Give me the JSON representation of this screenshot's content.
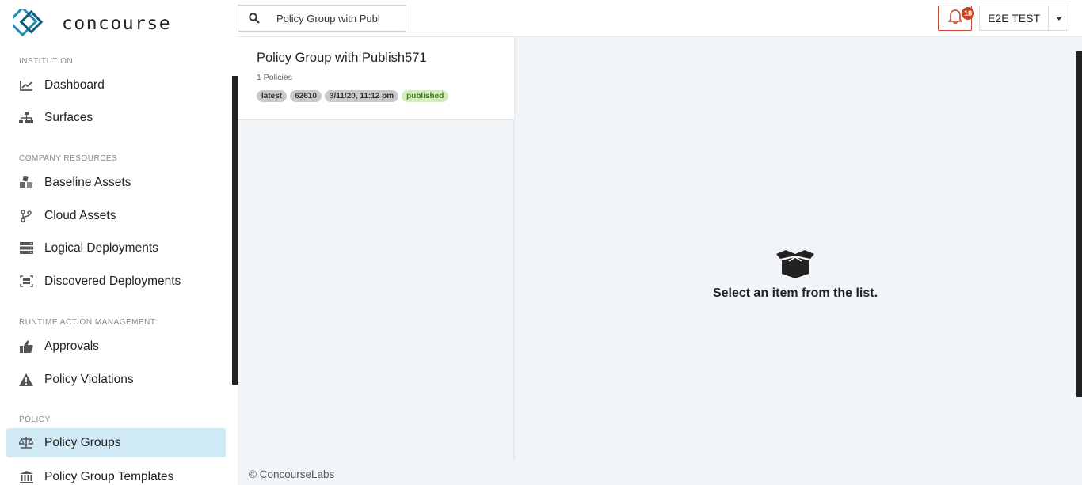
{
  "app": {
    "logo_text": "concourse"
  },
  "search": {
    "value": "Policy Group with Publ",
    "placeholder": "Search"
  },
  "header": {
    "notification_count": "18",
    "user_label": "E2E TEST"
  },
  "sidebar": {
    "sections": [
      "INSTITUTION",
      "COMPANY RESOURCES",
      "RUNTIME ACTION MANAGEMENT",
      "POLICY"
    ],
    "items": [
      {
        "label": "Dashboard",
        "icon": "chart-line-icon"
      },
      {
        "label": "Surfaces",
        "icon": "sitemap-icon"
      },
      {
        "label": "Baseline Assets",
        "icon": "cubes-icon"
      },
      {
        "label": "Cloud Assets",
        "icon": "code-branch-icon"
      },
      {
        "label": "Logical Deployments",
        "icon": "server-icon"
      },
      {
        "label": "Discovered Deployments",
        "icon": "scan-icon"
      },
      {
        "label": "Approvals",
        "icon": "thumbs-up-icon"
      },
      {
        "label": "Policy Violations",
        "icon": "warning-icon"
      },
      {
        "label": "Policy Groups",
        "icon": "balance-scale-icon",
        "active": true
      },
      {
        "label": "Policy Group Templates",
        "icon": "university-icon"
      }
    ]
  },
  "list": {
    "card": {
      "title": "Policy Group with Publish571",
      "subtitle": "1 Policies",
      "tags": [
        "latest",
        "62610",
        "3/11/20, 11:12 pm",
        "published"
      ]
    }
  },
  "detail": {
    "empty_message": "Select an item from the list.",
    "empty_icon": "open-box-icon"
  },
  "footer": {
    "text": "© ConcourseLabs"
  },
  "colors": {
    "accent": "#1fa3cf",
    "active_bg": "#cfeaf5",
    "alert": "#c8452a",
    "published_bg": "#d2ecbc"
  }
}
